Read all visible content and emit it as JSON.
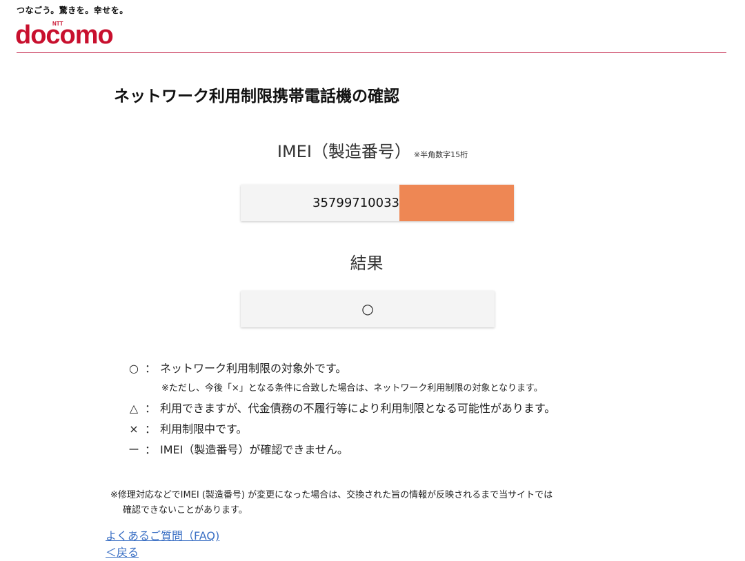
{
  "header": {
    "tagline": "つなごう。驚きを。幸せを。",
    "logo_small": "NTT",
    "logo_text": "docomo"
  },
  "page_title": "ネットワーク利用制限携帯電話機の確認",
  "imei": {
    "label": "IMEI（製造番号）",
    "note": "※半角数字15桁",
    "value": "35799710033"
  },
  "result": {
    "label": "結果",
    "value": "○"
  },
  "legend": [
    {
      "symbol": "○",
      "colon": "：",
      "text": "ネットワーク利用制限の対象外です。"
    },
    {
      "note": "※ただし、今後「×」となる条件に合致した場合は、ネットワーク利用制限の対象となります。"
    },
    {
      "symbol": "△",
      "colon": "：",
      "text": "利用できますが、代金債務の不履行等により利用制限となる可能性があります。"
    },
    {
      "symbol": "×",
      "colon": "：",
      "text": "利用制限中です。"
    },
    {
      "symbol": "ー",
      "colon": "：",
      "text": "IMEI（製造番号）が確認できません。"
    }
  ],
  "footnote": {
    "line1": "※修理対応などでIMEI (製造番号) が変更になった場合は、交換された旨の情報が反映されるまで当サイトでは",
    "line2": "確認できないことがあります。"
  },
  "links": {
    "faq": "よくあるご質問（FAQ)",
    "back": "＜戻る"
  },
  "colors": {
    "brand": "#c8102e",
    "link": "#3a6fc4",
    "redaction": "#ee8754",
    "box_bg": "#f4f4f4"
  }
}
